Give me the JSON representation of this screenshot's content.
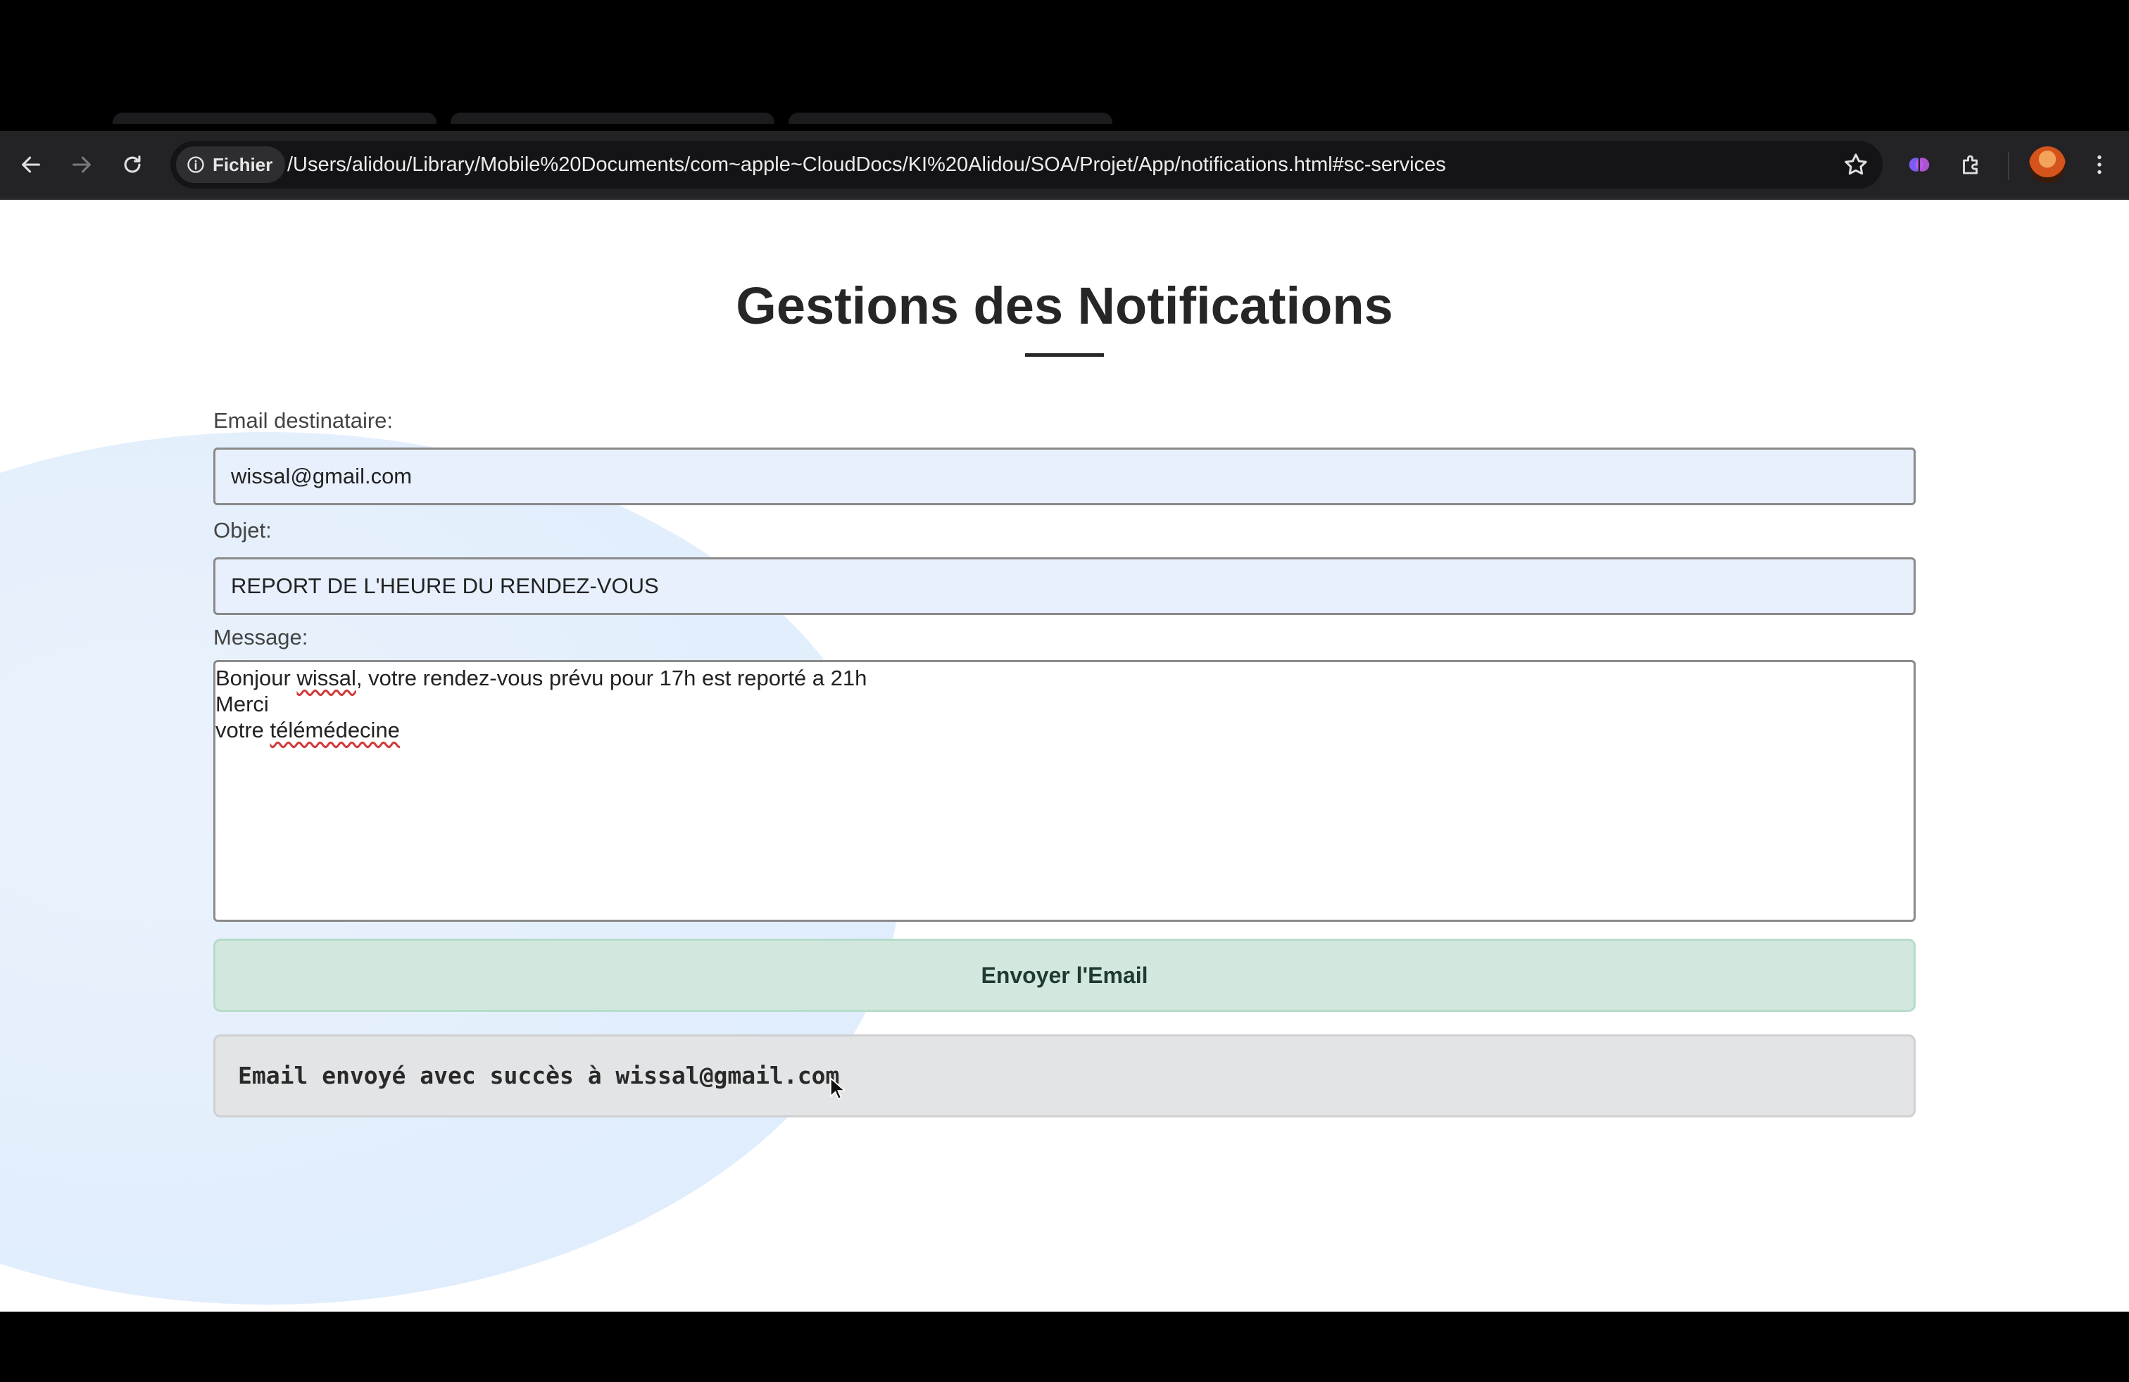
{
  "browser": {
    "site_chip_label": "Fichier",
    "url": "/Users/alidou/Library/Mobile%20Documents/com~apple~CloudDocs/KI%20Alidou/SOA/Projet/App/notifications.html#sc-services",
    "icons": [
      "back-icon",
      "forward-icon",
      "reload-icon",
      "info-icon",
      "star-icon",
      "extension-brain-icon",
      "puzzle-icon",
      "avatar",
      "kebab-menu-icon"
    ]
  },
  "page": {
    "title": "Gestions des Notifications",
    "email_label": "Email destinataire:",
    "email_value": "wissal@gmail.com",
    "subject_label": "Objet:",
    "subject_value": "REPORT DE L'HEURE DU RENDEZ-VOUS",
    "message_label": "Message:",
    "message_lines": {
      "l1_a": "Bonjour ",
      "l1_b": "wissal",
      "l1_c": ", votre rendez-vous prévu pour 17h est reporté a 21h",
      "l2": "Merci",
      "l3_a": "votre ",
      "l3_b": "télémédecine"
    },
    "send_button": "Envoyer l'Email",
    "result_text": "Email envoyé avec succès à wissal@gmail.com"
  },
  "colors": {
    "field_bg": "#e8f0fe",
    "button_bg": "#d2e8df",
    "result_bg": "#e3e4e6",
    "chrome_bg": "#232326"
  }
}
